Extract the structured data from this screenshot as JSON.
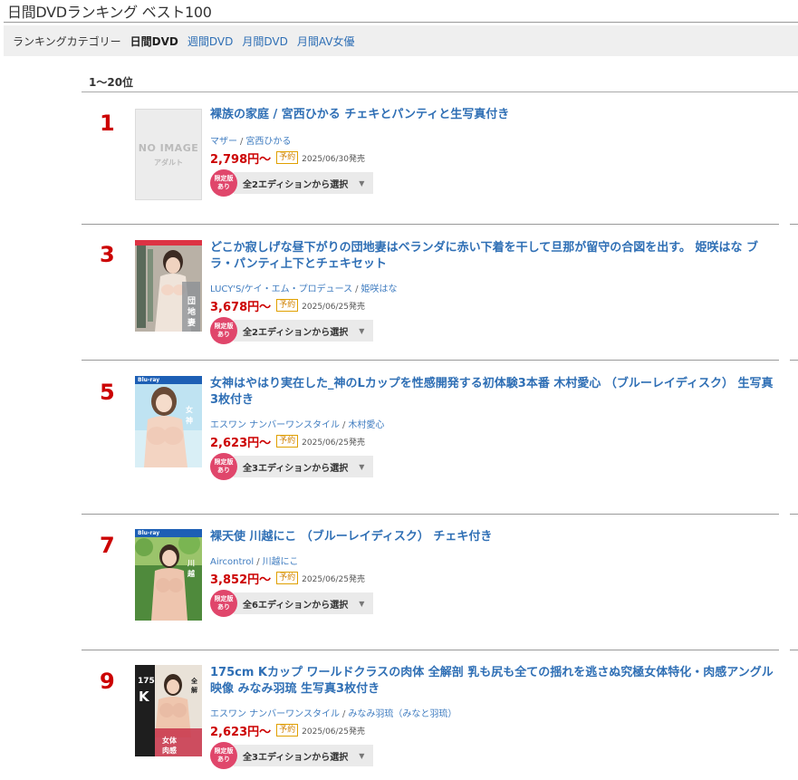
{
  "page": {
    "title": "日間DVDランキング ベスト100"
  },
  "categories": {
    "label": "ランキングカテゴリー",
    "current": "日間DVD",
    "links": [
      "週間DVD",
      "月間DVD",
      "月間AV女優"
    ]
  },
  "range_heading": "1〜20位",
  "items": [
    {
      "rank": "1",
      "title": "裸族の家庭 / 宮西ひかる チェキとパンティと生写真付き",
      "maker": "マザー",
      "actress": "宮西ひかる",
      "price": "2,798円〜",
      "reserve_badge": "予約",
      "release": "2025/06/30発売",
      "limited_line1": "限定版",
      "limited_line2": "あり",
      "edition": "全2エディションから選択",
      "thumb": {
        "type": "noimage",
        "line1": "NO IMAGE",
        "line2": "アダルト"
      }
    },
    {
      "rank": "3",
      "title": "どこか寂しげな昼下がりの団地妻はベランダに赤い下着を干して旦那が留守の合図を出す。 姫咲はな ブラ・パンティ上下とチェキセット",
      "maker": "LUCY'S/ケイ・エム・プロデュース",
      "actress": "姫咲はな",
      "price": "3,678円〜",
      "reserve_badge": "予約",
      "release": "2025/06/25発売",
      "limited_line1": "限定版",
      "limited_line2": "あり",
      "edition": "全2エディションから選択",
      "thumb": {
        "type": "cover",
        "bluray": ""
      }
    },
    {
      "rank": "5",
      "title": "女神はやはり実在した_神のLカップを性感開発する初体験3本番 木村愛心 （ブルーレイディスク） 生写真3枚付き",
      "maker": "エスワン ナンバーワンスタイル",
      "actress": "木村愛心",
      "price": "2,623円〜",
      "reserve_badge": "予約",
      "release": "2025/06/25発売",
      "limited_line1": "限定版",
      "limited_line2": "あり",
      "edition": "全3エディションから選択",
      "thumb": {
        "type": "cover",
        "bluray": "Blu-ray"
      }
    },
    {
      "rank": "7",
      "title": "裸天使 川越にこ （ブルーレイディスク） チェキ付き",
      "maker": "Aircontrol",
      "actress": "川越にこ",
      "price": "3,852円〜",
      "reserve_badge": "予約",
      "release": "2025/06/25発売",
      "limited_line1": "限定版",
      "limited_line2": "あり",
      "edition": "全6エディションから選択",
      "thumb": {
        "type": "cover",
        "bluray": "Blu-ray"
      }
    },
    {
      "rank": "9",
      "title": "175cm Kカップ ワールドクラスの肉体 全解剖 乳も尻も全ての揺れを逃さぬ究極女体特化・肉感アングル映像 みなみ羽琉 生写真3枚付き",
      "maker": "エスワン ナンバーワンスタイル",
      "actress": "みなみ羽琉（みなと羽琉）",
      "price": "2,623円〜",
      "reserve_badge": "予約",
      "release": "2025/06/25発売",
      "limited_line1": "限定版",
      "limited_line2": "あり",
      "edition": "全3エディションから選択",
      "thumb": {
        "type": "cover",
        "bluray": "",
        "overlay_text_1": "175",
        "overlay_text_2": "K"
      }
    }
  ],
  "colors": {
    "link_blue": "#2f6fb5",
    "rank_red": "#cc0000",
    "limited_pink": "#e0466b",
    "reserve_orange": "#d08000"
  }
}
